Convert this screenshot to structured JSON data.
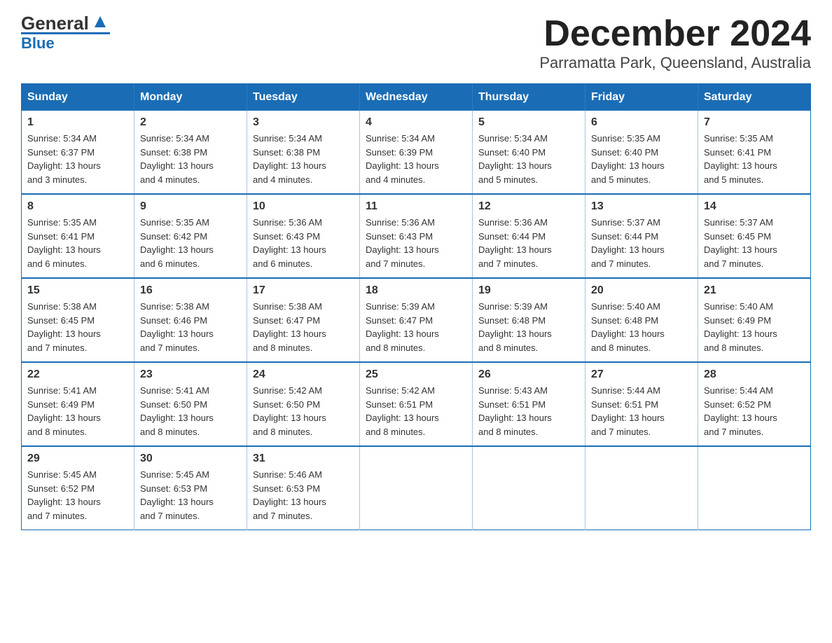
{
  "logo": {
    "general": "General",
    "blue": "Blue",
    "triangle": "▲"
  },
  "header": {
    "month": "December 2024",
    "location": "Parramatta Park, Queensland, Australia"
  },
  "weekdays": [
    "Sunday",
    "Monday",
    "Tuesday",
    "Wednesday",
    "Thursday",
    "Friday",
    "Saturday"
  ],
  "weeks": [
    [
      {
        "day": "1",
        "sunrise": "Sunrise: 5:34 AM",
        "sunset": "Sunset: 6:37 PM",
        "daylight": "Daylight: 13 hours and 3 minutes."
      },
      {
        "day": "2",
        "sunrise": "Sunrise: 5:34 AM",
        "sunset": "Sunset: 6:38 PM",
        "daylight": "Daylight: 13 hours and 4 minutes."
      },
      {
        "day": "3",
        "sunrise": "Sunrise: 5:34 AM",
        "sunset": "Sunset: 6:38 PM",
        "daylight": "Daylight: 13 hours and 4 minutes."
      },
      {
        "day": "4",
        "sunrise": "Sunrise: 5:34 AM",
        "sunset": "Sunset: 6:39 PM",
        "daylight": "Daylight: 13 hours and 4 minutes."
      },
      {
        "day": "5",
        "sunrise": "Sunrise: 5:34 AM",
        "sunset": "Sunset: 6:40 PM",
        "daylight": "Daylight: 13 hours and 5 minutes."
      },
      {
        "day": "6",
        "sunrise": "Sunrise: 5:35 AM",
        "sunset": "Sunset: 6:40 PM",
        "daylight": "Daylight: 13 hours and 5 minutes."
      },
      {
        "day": "7",
        "sunrise": "Sunrise: 5:35 AM",
        "sunset": "Sunset: 6:41 PM",
        "daylight": "Daylight: 13 hours and 5 minutes."
      }
    ],
    [
      {
        "day": "8",
        "sunrise": "Sunrise: 5:35 AM",
        "sunset": "Sunset: 6:41 PM",
        "daylight": "Daylight: 13 hours and 6 minutes."
      },
      {
        "day": "9",
        "sunrise": "Sunrise: 5:35 AM",
        "sunset": "Sunset: 6:42 PM",
        "daylight": "Daylight: 13 hours and 6 minutes."
      },
      {
        "day": "10",
        "sunrise": "Sunrise: 5:36 AM",
        "sunset": "Sunset: 6:43 PM",
        "daylight": "Daylight: 13 hours and 6 minutes."
      },
      {
        "day": "11",
        "sunrise": "Sunrise: 5:36 AM",
        "sunset": "Sunset: 6:43 PM",
        "daylight": "Daylight: 13 hours and 7 minutes."
      },
      {
        "day": "12",
        "sunrise": "Sunrise: 5:36 AM",
        "sunset": "Sunset: 6:44 PM",
        "daylight": "Daylight: 13 hours and 7 minutes."
      },
      {
        "day": "13",
        "sunrise": "Sunrise: 5:37 AM",
        "sunset": "Sunset: 6:44 PM",
        "daylight": "Daylight: 13 hours and 7 minutes."
      },
      {
        "day": "14",
        "sunrise": "Sunrise: 5:37 AM",
        "sunset": "Sunset: 6:45 PM",
        "daylight": "Daylight: 13 hours and 7 minutes."
      }
    ],
    [
      {
        "day": "15",
        "sunrise": "Sunrise: 5:38 AM",
        "sunset": "Sunset: 6:45 PM",
        "daylight": "Daylight: 13 hours and 7 minutes."
      },
      {
        "day": "16",
        "sunrise": "Sunrise: 5:38 AM",
        "sunset": "Sunset: 6:46 PM",
        "daylight": "Daylight: 13 hours and 7 minutes."
      },
      {
        "day": "17",
        "sunrise": "Sunrise: 5:38 AM",
        "sunset": "Sunset: 6:47 PM",
        "daylight": "Daylight: 13 hours and 8 minutes."
      },
      {
        "day": "18",
        "sunrise": "Sunrise: 5:39 AM",
        "sunset": "Sunset: 6:47 PM",
        "daylight": "Daylight: 13 hours and 8 minutes."
      },
      {
        "day": "19",
        "sunrise": "Sunrise: 5:39 AM",
        "sunset": "Sunset: 6:48 PM",
        "daylight": "Daylight: 13 hours and 8 minutes."
      },
      {
        "day": "20",
        "sunrise": "Sunrise: 5:40 AM",
        "sunset": "Sunset: 6:48 PM",
        "daylight": "Daylight: 13 hours and 8 minutes."
      },
      {
        "day": "21",
        "sunrise": "Sunrise: 5:40 AM",
        "sunset": "Sunset: 6:49 PM",
        "daylight": "Daylight: 13 hours and 8 minutes."
      }
    ],
    [
      {
        "day": "22",
        "sunrise": "Sunrise: 5:41 AM",
        "sunset": "Sunset: 6:49 PM",
        "daylight": "Daylight: 13 hours and 8 minutes."
      },
      {
        "day": "23",
        "sunrise": "Sunrise: 5:41 AM",
        "sunset": "Sunset: 6:50 PM",
        "daylight": "Daylight: 13 hours and 8 minutes."
      },
      {
        "day": "24",
        "sunrise": "Sunrise: 5:42 AM",
        "sunset": "Sunset: 6:50 PM",
        "daylight": "Daylight: 13 hours and 8 minutes."
      },
      {
        "day": "25",
        "sunrise": "Sunrise: 5:42 AM",
        "sunset": "Sunset: 6:51 PM",
        "daylight": "Daylight: 13 hours and 8 minutes."
      },
      {
        "day": "26",
        "sunrise": "Sunrise: 5:43 AM",
        "sunset": "Sunset: 6:51 PM",
        "daylight": "Daylight: 13 hours and 8 minutes."
      },
      {
        "day": "27",
        "sunrise": "Sunrise: 5:44 AM",
        "sunset": "Sunset: 6:51 PM",
        "daylight": "Daylight: 13 hours and 7 minutes."
      },
      {
        "day": "28",
        "sunrise": "Sunrise: 5:44 AM",
        "sunset": "Sunset: 6:52 PM",
        "daylight": "Daylight: 13 hours and 7 minutes."
      }
    ],
    [
      {
        "day": "29",
        "sunrise": "Sunrise: 5:45 AM",
        "sunset": "Sunset: 6:52 PM",
        "daylight": "Daylight: 13 hours and 7 minutes."
      },
      {
        "day": "30",
        "sunrise": "Sunrise: 5:45 AM",
        "sunset": "Sunset: 6:53 PM",
        "daylight": "Daylight: 13 hours and 7 minutes."
      },
      {
        "day": "31",
        "sunrise": "Sunrise: 5:46 AM",
        "sunset": "Sunset: 6:53 PM",
        "daylight": "Daylight: 13 hours and 7 minutes."
      },
      null,
      null,
      null,
      null
    ]
  ]
}
